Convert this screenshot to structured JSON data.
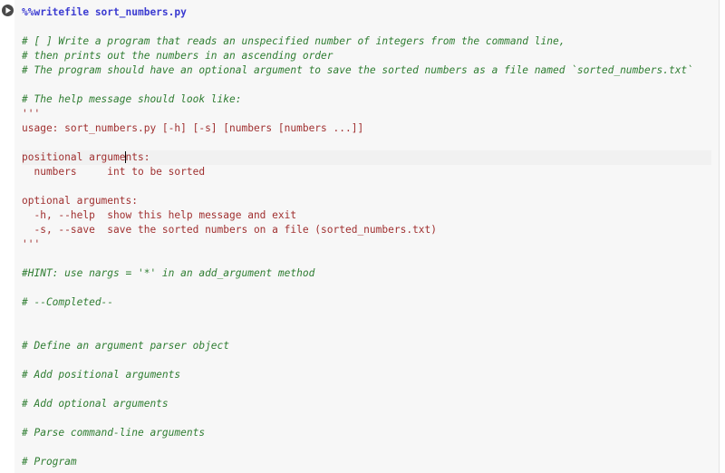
{
  "cell": {
    "magic_line": "%%writefile sort_numbers.py",
    "comment_task_1": "# [ ] Write a program that reads an unspecified number of integers from the command line,",
    "comment_task_2": "# then prints out the numbers in an ascending order",
    "comment_task_3": "# The program should have an optional argument to save the sorted numbers as a file named `sorted_numbers.txt`",
    "comment_help_hdr": "# The help message should look like:",
    "triple_quote": "'''",
    "usage_line": "usage: sort_numbers.py [-h] [-s] [numbers [numbers ...]]",
    "pos_hdr_a": "positional argum",
    "pos_hdr_cursor": "e",
    "pos_hdr_b": "nts:",
    "pos_numbers": "  numbers     int to be sorted",
    "opt_hdr": "optional arguments:",
    "opt_help": "  -h, --help  show this help message and exit",
    "opt_save": "  -s, --save  save the sorted numbers on a file (sorted_numbers.txt)",
    "comment_hint": "#HINT: use nargs = '*' in an add_argument method",
    "comment_completed": "# --Completed--",
    "comment_define": "# Define an argument parser object",
    "comment_addpos": "# Add positional arguments",
    "comment_addopt": "# Add optional arguments",
    "comment_parse": "# Parse command-line arguments",
    "comment_program": "# Program"
  },
  "icons": {
    "run": "play-icon"
  }
}
